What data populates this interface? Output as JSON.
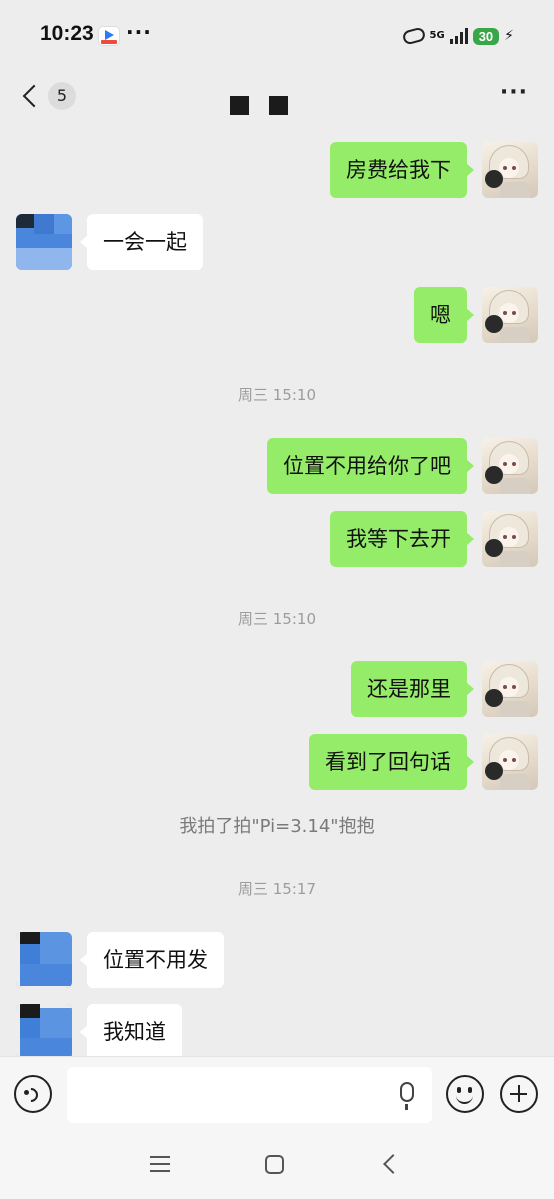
{
  "status_bar": {
    "time": "10:23",
    "more": "···",
    "network": "5G",
    "battery": "30"
  },
  "header": {
    "back_count": "5",
    "more": "···"
  },
  "messages": [
    {
      "side": "right",
      "text": "房费给我下"
    },
    {
      "side": "left",
      "text": "一会一起"
    },
    {
      "side": "right",
      "text": "嗯"
    },
    {
      "type": "time",
      "text": "周三 15:10"
    },
    {
      "side": "right",
      "text": "位置不用给你了吧"
    },
    {
      "side": "right",
      "text": "我等下去开"
    },
    {
      "type": "time",
      "text": "周三 15:10"
    },
    {
      "side": "right",
      "text": "还是那里"
    },
    {
      "side": "right",
      "text": "看到了回句话"
    },
    {
      "type": "system",
      "text": "我拍了拍\"Pi=3.14\"抱抱"
    },
    {
      "type": "time",
      "text": "周三 15:17"
    },
    {
      "side": "left",
      "text": "位置不用发"
    },
    {
      "side": "left",
      "text": "我知道"
    }
  ],
  "input": {
    "placeholder": ""
  },
  "colors": {
    "sent_bubble": "#95ec69",
    "received_bubble": "#ffffff",
    "background": "#ededed"
  },
  "icons": [
    "voice-icon",
    "microphone-icon",
    "emoji-icon",
    "plus-icon",
    "back-chevron-icon",
    "more-icon"
  ]
}
